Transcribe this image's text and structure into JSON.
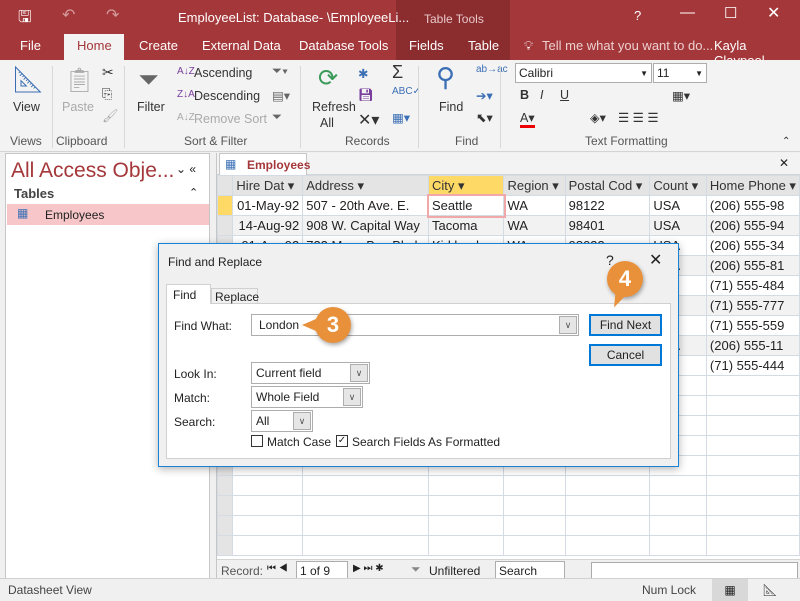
{
  "window": {
    "title": "EmployeeList: Database- \\EmployeeLi...",
    "context_tab": "Table Tools",
    "help": "?",
    "user": "Kayla Claypool",
    "tell_me": "Tell me what you want to do..."
  },
  "ribbon_tabs": [
    "File",
    "Home",
    "Create",
    "External Data",
    "Database Tools",
    "Fields",
    "Table"
  ],
  "ribbon": {
    "views": {
      "label": "Views",
      "view": "View"
    },
    "clipboard": {
      "label": "Clipboard",
      "paste": "Paste"
    },
    "sort_filter": {
      "label": "Sort & Filter",
      "filter": "Filter",
      "ascending": "Ascending",
      "descending": "Descending",
      "remove_sort": "Remove Sort"
    },
    "records": {
      "label": "Records",
      "refresh": "Refresh",
      "all": "All"
    },
    "find": {
      "label": "Find",
      "find": "Find"
    },
    "text_formatting": {
      "label": "Text Formatting",
      "font": "Calibri",
      "size": "11"
    }
  },
  "nav": {
    "title": "All Access Obje...",
    "section": "Tables",
    "items": [
      "Employees"
    ]
  },
  "doc_tab": "Employees",
  "table": {
    "columns": [
      "Hire Dat",
      "Address",
      "City",
      "Region",
      "Postal Cod",
      "Count",
      "Home Phone"
    ],
    "rows": [
      [
        "01-May-92",
        "507 - 20th Ave. E.",
        "Seattle",
        "WA",
        "98122",
        "USA",
        "(206) 555-98"
      ],
      [
        "14-Aug-92",
        "908 W. Capital Way",
        "Tacoma",
        "WA",
        "98401",
        "USA",
        "(206) 555-94"
      ],
      [
        "01-Apr-92",
        "722 Moss Bay Blvd.",
        "Kirkland",
        "WA",
        "98033",
        "USA",
        "(206) 555-34"
      ],
      [
        "",
        "",
        "",
        "",
        "",
        "USA",
        "(206) 555-81"
      ],
      [
        "",
        "",
        "",
        "",
        "",
        "UK",
        "(71) 555-484"
      ],
      [
        "",
        "",
        "",
        "",
        "",
        "UK",
        "(71) 555-777"
      ],
      [
        "",
        "",
        "",
        "",
        "",
        "UK",
        "(71) 555-559"
      ],
      [
        "",
        "",
        "",
        "",
        "",
        "USA",
        "(206) 555-11"
      ],
      [
        "",
        "",
        "",
        "",
        "",
        "UK",
        "(71) 555-444"
      ]
    ]
  },
  "record_nav": {
    "label": "Record:",
    "position": "1 of 9",
    "filter": "Unfiltered",
    "search": "Search"
  },
  "dialog": {
    "title": "Find and Replace",
    "tabs": [
      "Find",
      "Replace"
    ],
    "find_what_label": "Find What:",
    "find_what": "London",
    "look_in_label": "Look In:",
    "look_in": "Current field",
    "match_label": "Match:",
    "match": "Whole Field",
    "search_label": "Search:",
    "search": "All",
    "match_case": "Match Case",
    "match_case_checked": false,
    "search_formatted": "Search Fields As Formatted",
    "search_formatted_checked": true,
    "find_next": "Find Next",
    "cancel": "Cancel"
  },
  "callouts": [
    "3",
    "4"
  ],
  "status": {
    "view": "Datasheet View",
    "num_lock": "Num Lock"
  },
  "colors": {
    "accent": "#a4373a",
    "callout": "#e8913a",
    "selected": "#ffd966"
  }
}
